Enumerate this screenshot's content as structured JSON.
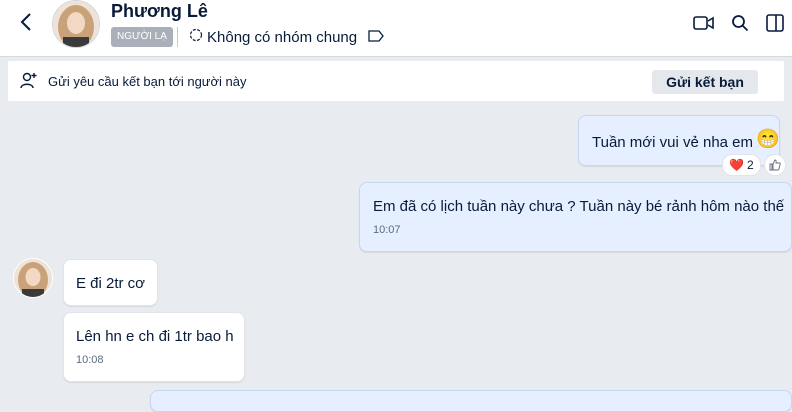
{
  "header": {
    "name": "Phương Lê",
    "badge": "NGƯỜI LẠ",
    "group_status": "Không có nhóm chung"
  },
  "friend_bar": {
    "text": "Gửi yêu cầu kết bạn tới người này",
    "button": "Gửi kết bạn"
  },
  "messages": [
    {
      "text": "Tuần mới vui vẻ nha em",
      "emoji": "😁"
    },
    {
      "text": "Em đã có lịch tuần này chưa ? Tuần này bé rảnh hôm nào thế",
      "time": "10:07"
    },
    {
      "text": "E đi 2tr cơ"
    },
    {
      "text": "Lên hn e ch đi 1tr bao h",
      "time": "10:08"
    }
  ],
  "reaction": {
    "emoji": "❤️",
    "count": "2"
  },
  "icons": [
    "back-icon",
    "video-call-icon",
    "search-icon",
    "sidebar-toggle-icon",
    "group-icon",
    "tag-icon",
    "add-friend-icon",
    "like-icon"
  ],
  "colors": {
    "outgoing": "#e5efff",
    "incoming": "#ffffff",
    "background": "#e8ebef"
  }
}
